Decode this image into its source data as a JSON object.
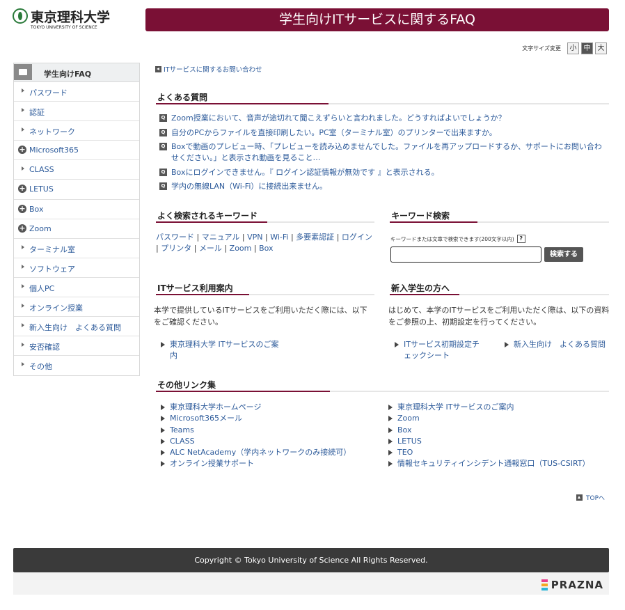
{
  "header": {
    "logo_name": "東京理科大学",
    "logo_sub": "TOKYO UNIVERSITY OF SCIENCE",
    "banner_title": "学生向けITサービスに関するFAQ"
  },
  "font_size": {
    "label": "文字サイズ変更",
    "small": "小",
    "medium": "中",
    "large": "大",
    "selected": "中"
  },
  "sidebar": {
    "title": "学生向けFAQ",
    "items": [
      {
        "label": "パスワード",
        "icon": "arrow"
      },
      {
        "label": "認証",
        "icon": "arrow"
      },
      {
        "label": "ネットワーク",
        "icon": "arrow"
      },
      {
        "label": "Microsoft365",
        "icon": "plus"
      },
      {
        "label": "CLASS",
        "icon": "arrow"
      },
      {
        "label": "LETUS",
        "icon": "plus"
      },
      {
        "label": "Box",
        "icon": "plus"
      },
      {
        "label": "Zoom",
        "icon": "plus"
      },
      {
        "label": "ターミナル室",
        "icon": "arrow"
      },
      {
        "label": "ソフトウェア",
        "icon": "arrow"
      },
      {
        "label": "個人PC",
        "icon": "arrow"
      },
      {
        "label": "オンライン授業",
        "icon": "arrow"
      },
      {
        "label": "新入生向け　よくある質問",
        "icon": "arrow"
      },
      {
        "label": "安否確認",
        "icon": "arrow"
      },
      {
        "label": "その他",
        "icon": "arrow"
      }
    ]
  },
  "contact_link": "ITサービスに関するお問い合わせ",
  "faq": {
    "heading": "よくある質問",
    "q_badge": "Q",
    "items": [
      "Zoom授業において、音声が途切れて聞こえずらいと言われました。どうすればよいでしょうか？",
      "自分のPCからファイルを直接印刷したい。PC室（ターミナル室）のプリンターで出来ますか。",
      "Boxで動画のプレビュー時、「プレビューを読み込めませんでした。ファイルを再アップロードするか、サポートにお問い合わせください。」と表示され動画を見ること…",
      "Boxにログインできません。『 ログイン認証情報が無効です 』と表示される。",
      "学内の無線LAN（Wi-Fi）に接続出来ません。"
    ]
  },
  "keywords": {
    "heading": "よく検索されるキーワード",
    "items": [
      "パスワード",
      "マニュアル",
      "VPN",
      "Wi-Fi",
      "多要素認証",
      "ログイン",
      "プリンタ",
      "メール",
      "Zoom",
      "Box"
    ],
    "separator": "|"
  },
  "search": {
    "heading": "キーワード検索",
    "hint": "キーワードまたは文章で検索できます(200文字以内)",
    "help": "?",
    "value": "",
    "button": "検索する"
  },
  "it_guide": {
    "heading": "ITサービス利用案内",
    "description": "本学で提供しているITサービスをご利用いただく際には、以下をご確認ください。",
    "links": [
      "東京理科大学 ITサービスのご案内"
    ]
  },
  "freshmen": {
    "heading": "新入学生の方へ",
    "description": "はじめて、本学のITサービスをご利用いただく際は、以下の資料をご参照の上、初期設定を行ってください。",
    "links": [
      "ITサービス初期設定チェックシート",
      "新入生向け　よくある質問"
    ]
  },
  "other_links": {
    "heading": "その他リンク集",
    "left": [
      "東京理科大学ホームページ",
      "Microsoft365メール",
      "Teams",
      "CLASS",
      "ALC NetAcademy（学内ネットワークのみ接続可）",
      "オンライン授業サポート"
    ],
    "right": [
      "東京理科大学 ITサービスのご案内",
      "Zoom",
      "Box",
      "LETUS",
      "TEO",
      "情報セキュリティインシデント通報窓口（TUS-CSIRT）"
    ]
  },
  "page_top": "TOPへ",
  "footer": {
    "copyright": "Copyright © Tokyo University of Science All Rights Reserved.",
    "brand": "PRAZNA"
  },
  "colors": {
    "accent": "#7a1035",
    "link": "#2c5a9a",
    "footer_bg": "#3a3a3a"
  }
}
